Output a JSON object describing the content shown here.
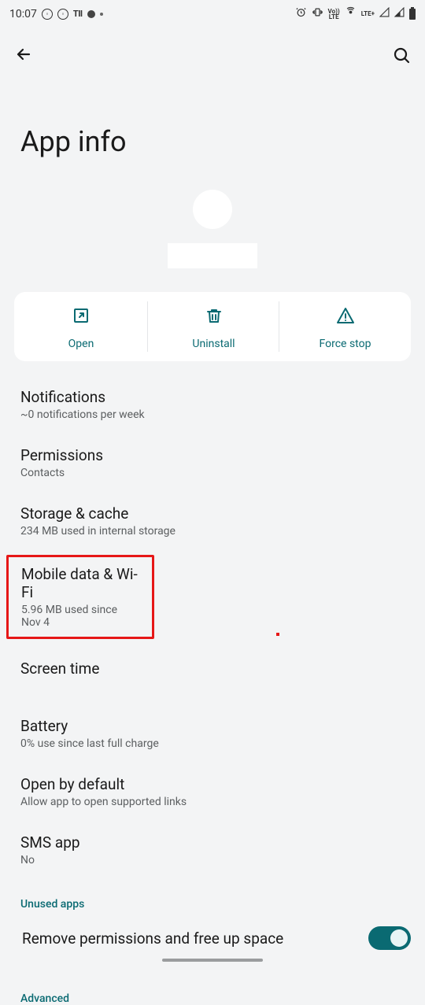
{
  "status": {
    "time": "10:07",
    "tii": "TII",
    "lte_label": "LTE+",
    "volte": "Vo)) LTE"
  },
  "header": {
    "page_title": "App info"
  },
  "actions": {
    "open": "Open",
    "uninstall": "Uninstall",
    "force_stop": "Force stop"
  },
  "settings": {
    "notifications": {
      "title": "Notifications",
      "sub": "~0 notifications per week"
    },
    "permissions": {
      "title": "Permissions",
      "sub": "Contacts"
    },
    "storage": {
      "title": "Storage & cache",
      "sub": "234 MB used in internal storage"
    },
    "mobile_data": {
      "title": "Mobile data & Wi-Fi",
      "sub": "5.96 MB used since Nov 4"
    },
    "screen_time": {
      "title": "Screen time"
    },
    "battery": {
      "title": "Battery",
      "sub": "0% use since last full charge"
    },
    "open_default": {
      "title": "Open by default",
      "sub": "Allow app to open supported links"
    },
    "sms": {
      "title": "SMS app",
      "sub": "No"
    }
  },
  "sections": {
    "unused": "Unused apps",
    "advanced": "Advanced"
  },
  "toggle": {
    "remove_label": "Remove permissions and free up space"
  }
}
